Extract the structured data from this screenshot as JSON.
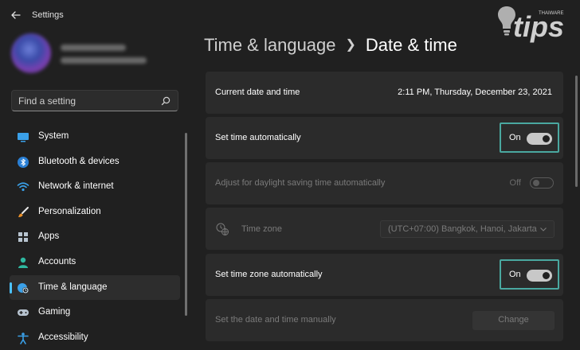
{
  "app": {
    "title": "Settings"
  },
  "logo": {
    "text": "tips",
    "small_text": "THAIWARE"
  },
  "search": {
    "placeholder": "Find a setting"
  },
  "sidebar": {
    "items": [
      {
        "label": "System",
        "icon": "monitor-icon"
      },
      {
        "label": "Bluetooth & devices",
        "icon": "bluetooth-icon"
      },
      {
        "label": "Network & internet",
        "icon": "wifi-icon"
      },
      {
        "label": "Personalization",
        "icon": "brush-icon"
      },
      {
        "label": "Apps",
        "icon": "apps-icon"
      },
      {
        "label": "Accounts",
        "icon": "person-icon"
      },
      {
        "label": "Time & language",
        "icon": "globe-clock-icon",
        "selected": true
      },
      {
        "label": "Gaming",
        "icon": "gamepad-icon"
      },
      {
        "label": "Accessibility",
        "icon": "accessibility-icon"
      }
    ]
  },
  "breadcrumb": {
    "parent": "Time & language",
    "current": "Date & time"
  },
  "settings": {
    "current": {
      "label": "Current date and time",
      "value": "2:11 PM, Thursday, December 23, 2021"
    },
    "auto_time": {
      "label": "Set time automatically",
      "state": "On"
    },
    "dst": {
      "label": "Adjust for daylight saving time automatically",
      "state": "Off"
    },
    "timezone": {
      "label": "Time zone",
      "value": "(UTC+07:00) Bangkok, Hanoi, Jakarta"
    },
    "auto_timezone": {
      "label": "Set time zone automatically",
      "state": "On"
    },
    "manual": {
      "label": "Set the date and time manually",
      "button": "Change"
    }
  },
  "colors": {
    "accent": "#4cc2ff",
    "highlight_border": "#4aa8a0",
    "background": "#202020",
    "card": "#2b2b2b"
  }
}
